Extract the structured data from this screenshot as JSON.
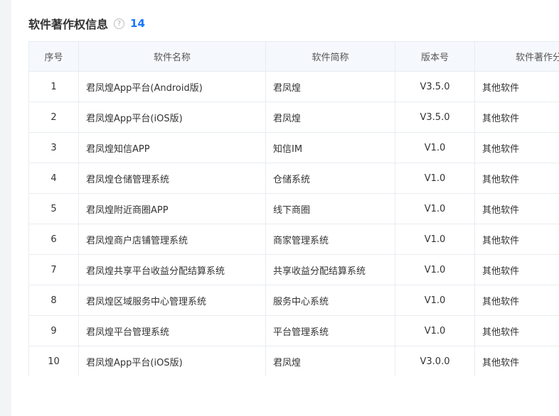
{
  "section": {
    "title": "软件著作权信息",
    "help_icon": "question-circle-icon",
    "count": "14"
  },
  "table": {
    "headers": [
      "序号",
      "软件名称",
      "软件简称",
      "版本号",
      "软件著作分类"
    ],
    "rows": [
      {
        "index": "1",
        "name": "君凤煌App平台(Android版)",
        "short": "君凤煌",
        "version": "V3.5.0",
        "category": "其他软件"
      },
      {
        "index": "2",
        "name": "君凤煌App平台(iOS版)",
        "short": "君凤煌",
        "version": "V3.5.0",
        "category": "其他软件"
      },
      {
        "index": "3",
        "name": "君凤煌知信APP",
        "short": "知信IM",
        "version": "V1.0",
        "category": "其他软件"
      },
      {
        "index": "4",
        "name": "君凤煌仓储管理系统",
        "short": "仓储系统",
        "version": "V1.0",
        "category": "其他软件"
      },
      {
        "index": "5",
        "name": "君凤煌附近商圈APP",
        "short": "线下商圈",
        "version": "V1.0",
        "category": "其他软件"
      },
      {
        "index": "6",
        "name": "君凤煌商户店铺管理系统",
        "short": "商家管理系统",
        "version": "V1.0",
        "category": "其他软件"
      },
      {
        "index": "7",
        "name": "君凤煌共享平台收益分配结算系统",
        "short": "共享收益分配结算系统",
        "version": "V1.0",
        "category": "其他软件"
      },
      {
        "index": "8",
        "name": "君凤煌区域服务中心管理系统",
        "short": "服务中心系统",
        "version": "V1.0",
        "category": "其他软件"
      },
      {
        "index": "9",
        "name": "君凤煌平台管理系统",
        "short": "平台管理系统",
        "version": "V1.0",
        "category": "其他软件"
      },
      {
        "index": "10",
        "name": "君凤煌App平台(iOS版)",
        "short": "君凤煌",
        "version": "V3.0.0",
        "category": "其他软件"
      }
    ]
  },
  "colors": {
    "accent": "#1677ff",
    "header_bg": "#f5f8fd",
    "border": "#e8ecf1"
  }
}
